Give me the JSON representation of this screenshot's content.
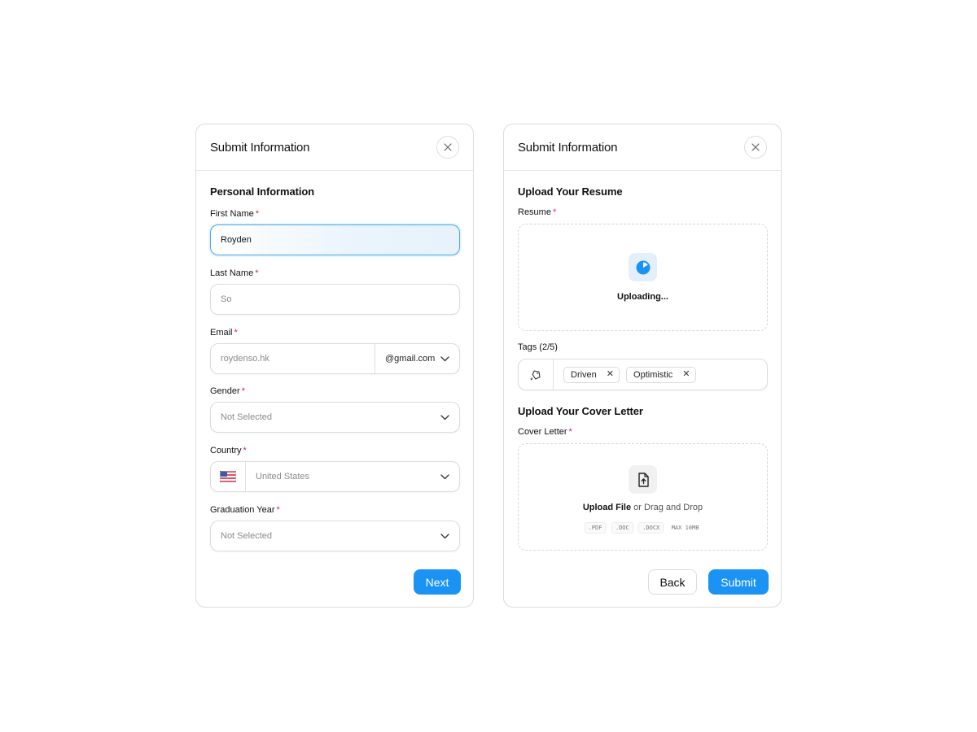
{
  "colors": {
    "accent": "#1a93f5",
    "required": "#e0243a",
    "focus_border": "#46a6ef"
  },
  "left_card": {
    "title": "Submit Information",
    "close_icon": "close-icon",
    "section_title": "Personal Information",
    "required_mark": "*",
    "first_name": {
      "label": "First Name",
      "value": "Royden"
    },
    "last_name": {
      "label": "Last Name",
      "placeholder": "So"
    },
    "email": {
      "label": "Email",
      "placeholder": "roydenso.hk",
      "domain": "@gmail.com"
    },
    "gender": {
      "label": "Gender",
      "value": "Not Selected"
    },
    "country": {
      "label": "Country",
      "value": "United States",
      "flag_icon": "us-flag-icon"
    },
    "graduation_year": {
      "label": "Graduation Year",
      "value": "Not Selected"
    },
    "next_label": "Next"
  },
  "right_card": {
    "title": "Submit Information",
    "close_icon": "close-icon",
    "resume_section_title": "Upload Your Resume",
    "resume_label": "Resume",
    "uploading_text": "Uploading...",
    "tags_label": "Tags (2/5)",
    "tags": [
      "Driven",
      "Optimistic"
    ],
    "tag_remove": "✕",
    "cover_section_title": "Upload Your Cover Letter",
    "cover_label": "Cover Letter",
    "upload_file": "Upload File",
    "drag_drop": " or Drag and Drop",
    "formats": [
      ".PDF",
      ".DOC",
      ".DOCX"
    ],
    "max_size": "MAX 10MB",
    "back_label": "Back",
    "submit_label": "Submit"
  }
}
